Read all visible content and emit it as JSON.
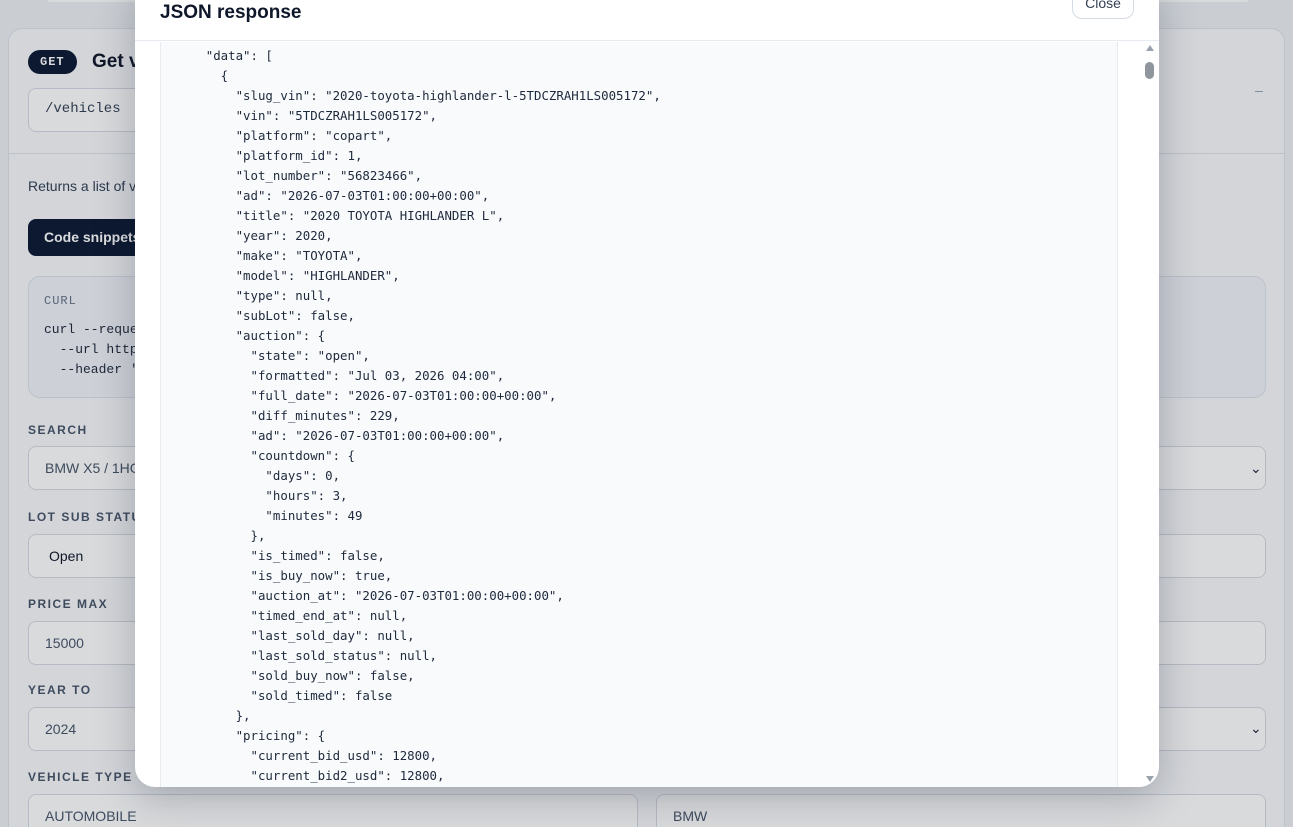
{
  "background": {
    "method_badge": "GET",
    "endpoint_title": "Get v",
    "path": "/vehicles",
    "description": "Returns a list of v",
    "code_snippets_button": "Code snippets",
    "curl_label": "CURL",
    "curl_lines": [
      "curl --reque",
      "  --url http",
      "  --header '"
    ],
    "fields": {
      "search_label": "SEARCH",
      "search_value": "BMW X5 / 1HG",
      "lot_sub_status_label": "LOT SUB STATU",
      "lot_sub_status_value": "Open",
      "price_max_label": "PRICE MAX",
      "price_max_value": "15000",
      "year_to_label": "YEAR TO",
      "year_to_value": "2024",
      "vehicle_type_label": "VEHICLE TYPE",
      "vehicle_type_value": "AUTOMOBILE",
      "make_value": "BMW"
    }
  },
  "modal": {
    "title": "JSON response",
    "close_label": "Close",
    "json_lines": [
      "      \"data\": [",
      "        {",
      "          \"slug_vin\": \"2020-toyota-highlander-l-5TDCZRAH1LS005172\",",
      "          \"vin\": \"5TDCZRAH1LS005172\",",
      "          \"platform\": \"copart\",",
      "          \"platform_id\": 1,",
      "          \"lot_number\": \"56823466\",",
      "          \"ad\": \"2026-07-03T01:00:00+00:00\",",
      "          \"title\": \"2020 TOYOTA HIGHLANDER L\",",
      "          \"year\": 2020,",
      "          \"make\": \"TOYOTA\",",
      "          \"model\": \"HIGHLANDER\",",
      "          \"type\": null,",
      "          \"subLot\": false,",
      "          \"auction\": {",
      "            \"state\": \"open\",",
      "            \"formatted\": \"Jul 03, 2026 04:00\",",
      "            \"full_date\": \"2026-07-03T01:00:00+00:00\",",
      "            \"diff_minutes\": 229,",
      "            \"ad\": \"2026-07-03T01:00:00+00:00\",",
      "            \"countdown\": {",
      "              \"days\": 0,",
      "              \"hours\": 3,",
      "              \"minutes\": 49",
      "            },",
      "            \"is_timed\": false,",
      "            \"is_buy_now\": true,",
      "            \"auction_at\": \"2026-07-03T01:00:00+00:00\",",
      "            \"timed_end_at\": null,",
      "            \"last_sold_day\": null,",
      "            \"last_sold_status\": null,",
      "            \"sold_buy_now\": false,",
      "            \"sold_timed\": false",
      "          },",
      "          \"pricing\": {",
      "            \"current_bid_usd\": 12800,",
      "            \"current_bid2_usd\": 12800,"
    ]
  }
}
